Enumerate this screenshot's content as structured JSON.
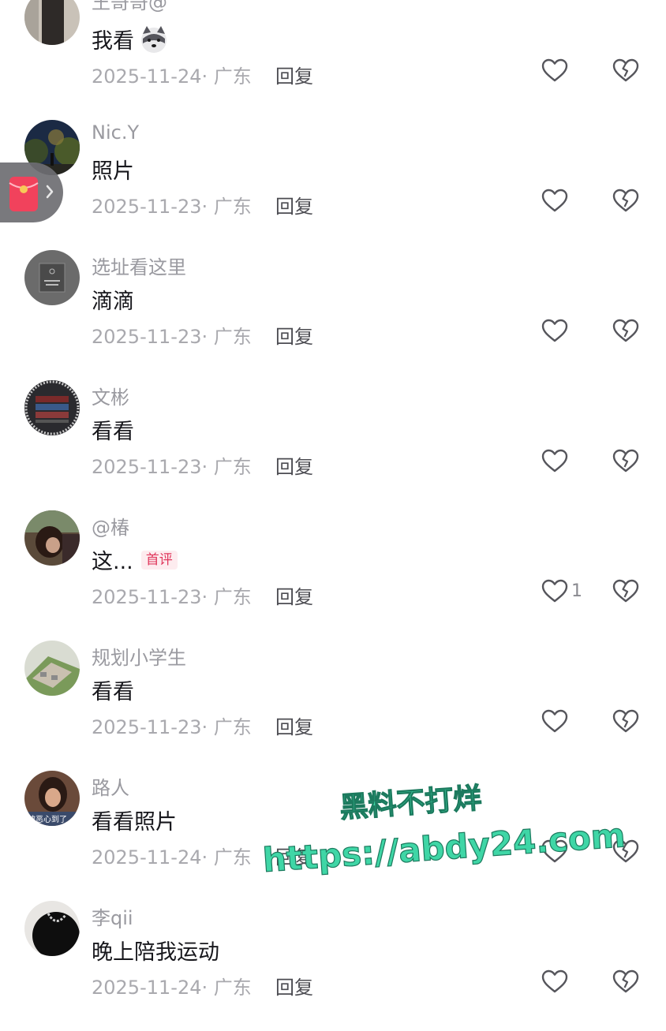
{
  "comments": [
    {
      "name": "王哥哥@",
      "text": "我看",
      "emoji": "husky-emoji",
      "date": "2025-11-24",
      "location": "广东",
      "reply": "回复",
      "likes": ""
    },
    {
      "name": "Nic.Y",
      "text": "照片",
      "date": "2025-11-23",
      "location": "广东",
      "reply": "回复",
      "likes": ""
    },
    {
      "name": "选址看这里",
      "text": "滴滴",
      "date": "2025-11-23",
      "location": "广东",
      "reply": "回复",
      "likes": ""
    },
    {
      "name": "文彬",
      "text": "看看",
      "date": "2025-11-23",
      "location": "广东",
      "reply": "回复",
      "likes": ""
    },
    {
      "name": "@椿",
      "text": "这...",
      "badge": "首评",
      "date": "2025-11-23",
      "location": "广东",
      "reply": "回复",
      "likes": "1"
    },
    {
      "name": "规划小学生",
      "text": "看看",
      "date": "2025-11-23",
      "location": "广东",
      "reply": "回复",
      "likes": ""
    },
    {
      "name": "路人",
      "text": "看看照片",
      "date": "2025-11-24",
      "location": "广东",
      "reply": "回复",
      "likes": ""
    },
    {
      "name": "李qii",
      "text": "晚上陪我运动",
      "date": "2025-11-24",
      "location": "广东",
      "reply": "回复",
      "likes": ""
    }
  ],
  "meta_separator": "·",
  "avatar_captions": {
    "comment_7": "被恶心到了"
  },
  "watermark": {
    "line1": "黑料不打烊",
    "line2": "https://abdy24.com",
    "color": "#3fd6a6"
  },
  "icons": {
    "like": "heart-outline-icon",
    "dislike": "broken-heart-icon",
    "side": "red-envelope-icon"
  },
  "colors": {
    "text": "#17171c",
    "name": "#9a9aa0",
    "meta": "#a9a9ae",
    "reply": "#4c4c52",
    "badge": "#e0375c"
  }
}
